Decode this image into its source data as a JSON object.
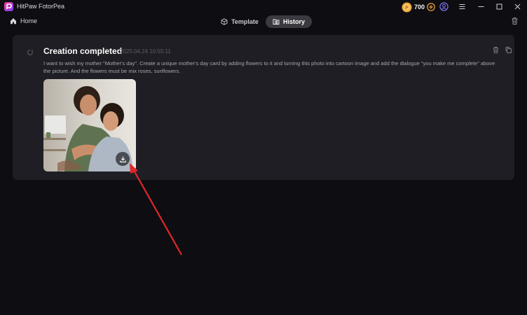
{
  "app": {
    "title": "HitPaw FotorPea",
    "credits": "700"
  },
  "nav": {
    "home_label": "Home",
    "tabs": [
      {
        "label": "Template",
        "active": false
      },
      {
        "label": "History",
        "active": true
      }
    ]
  },
  "history_item": {
    "title": "Creation completed",
    "timestamp": "2025.04.24 10:55:11",
    "prompt": "I want to wish my mother \"Mother's day\". Create a unique mother's day card by adding flowers to it and turning this photo into cartoon image and add the dialogue \"you make me complete\" above the picture. And the flowers must be mix roses, sunflowers."
  },
  "colors": {
    "background": "#0e0d12",
    "card": "#1e1e24",
    "active_tab": "#3a3a41",
    "coin": "#f0a93a",
    "annotation_arrow": "#e0262a"
  },
  "icons": {
    "logo": "app-logo-icon",
    "coin": "coin-icon",
    "plus": "plus-icon",
    "avatar": "user-icon",
    "menu": "menu-icon",
    "minimize": "minimize-icon",
    "maximize": "maximize-icon",
    "close": "close-icon",
    "home": "home-icon",
    "template": "cube-icon",
    "history": "folder-clock-icon",
    "trash": "trash-icon",
    "copy": "copy-icon",
    "download": "download-icon"
  }
}
